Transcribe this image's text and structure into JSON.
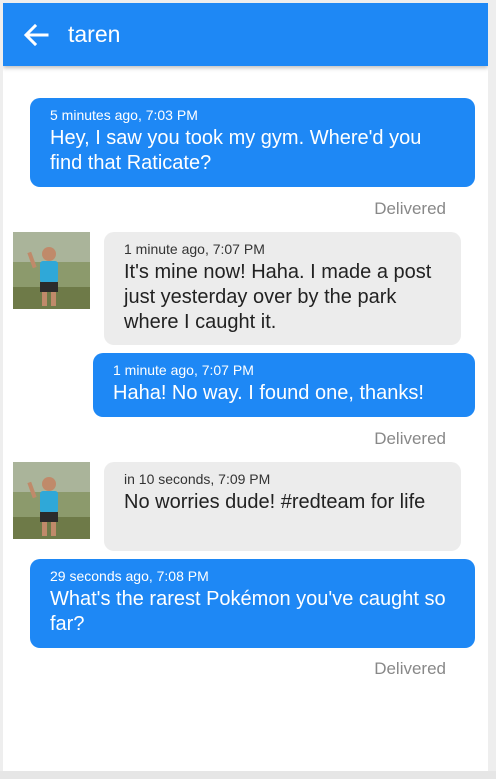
{
  "header": {
    "title": "taren",
    "back_icon": "arrow-left-icon"
  },
  "messages": [
    {
      "direction": "outgoing",
      "meta": "5 minutes ago, 7:03 PM",
      "text": "Hey, I saw you took my gym.  Where'd you find that Raticate?",
      "status": "Delivered"
    },
    {
      "direction": "incoming",
      "meta": "1 minute ago, 7:07 PM",
      "text": "It's mine now!  Haha.  I made a post just yesterday over by the park where I caught it."
    },
    {
      "direction": "outgoing",
      "meta": "1 minute ago, 7:07 PM",
      "text": "Haha!  No way.  I found one, thanks!",
      "status": "Delivered"
    },
    {
      "direction": "incoming",
      "meta": "in 10 seconds, 7:09 PM",
      "text": "No worries dude!  #redteam for life"
    },
    {
      "direction": "outgoing",
      "meta": "29 seconds ago, 7:08 PM",
      "text": "What's the rarest Pokémon you've caught so far?",
      "status": "Delivered"
    }
  ],
  "colors": {
    "accent": "#1e88f5",
    "incoming_bg": "#ececec",
    "status_text": "#888888"
  }
}
